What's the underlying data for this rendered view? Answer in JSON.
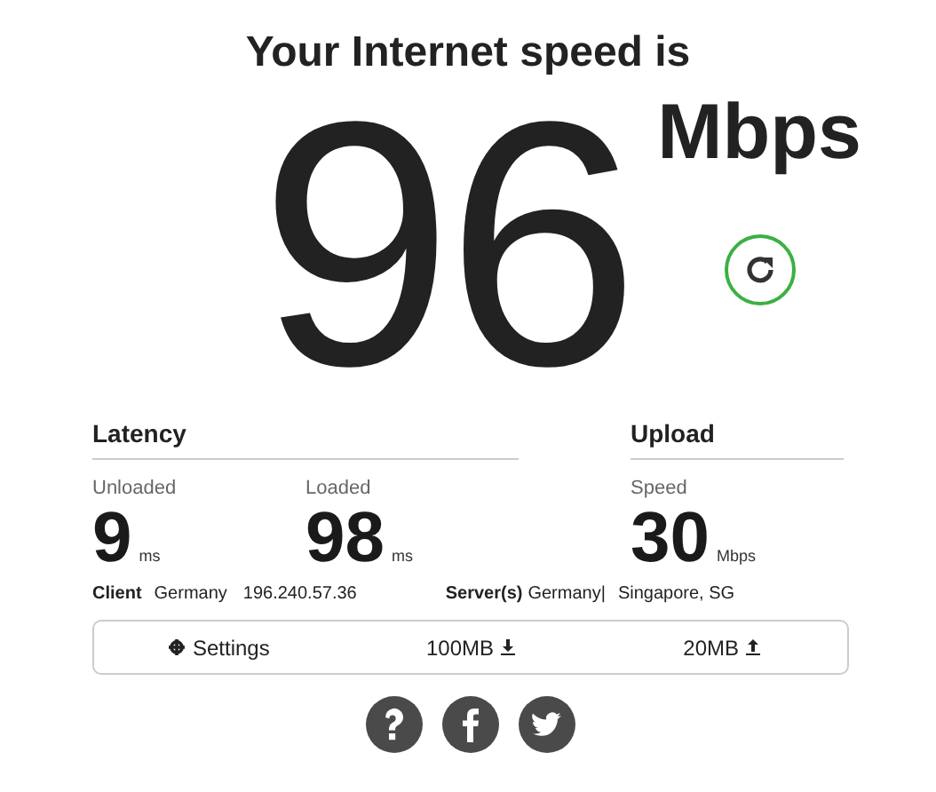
{
  "heading": "Your Internet speed is",
  "speed": {
    "value": "96",
    "unit": "Mbps"
  },
  "groups": [
    {
      "title": "Latency",
      "metrics": [
        {
          "label": "Unloaded",
          "value": "9",
          "unit": "ms"
        },
        {
          "label": "Loaded",
          "value": "98",
          "unit": "ms"
        }
      ]
    },
    {
      "title": "Upload",
      "metrics": [
        {
          "label": "Speed",
          "value": "30",
          "unit": "Mbps"
        }
      ]
    }
  ],
  "client": {
    "label": "Client",
    "location": "Germany",
    "ip": "196.240.57.36"
  },
  "servers": {
    "label": "Server(s)",
    "values": [
      "Germany|",
      "Singapore, SG"
    ]
  },
  "toolbar": {
    "settings": "Settings",
    "download_size": "100MB",
    "upload_size": "20MB"
  },
  "social": [
    {
      "kind": "help"
    },
    {
      "kind": "facebook"
    },
    {
      "kind": "twitter"
    }
  ]
}
